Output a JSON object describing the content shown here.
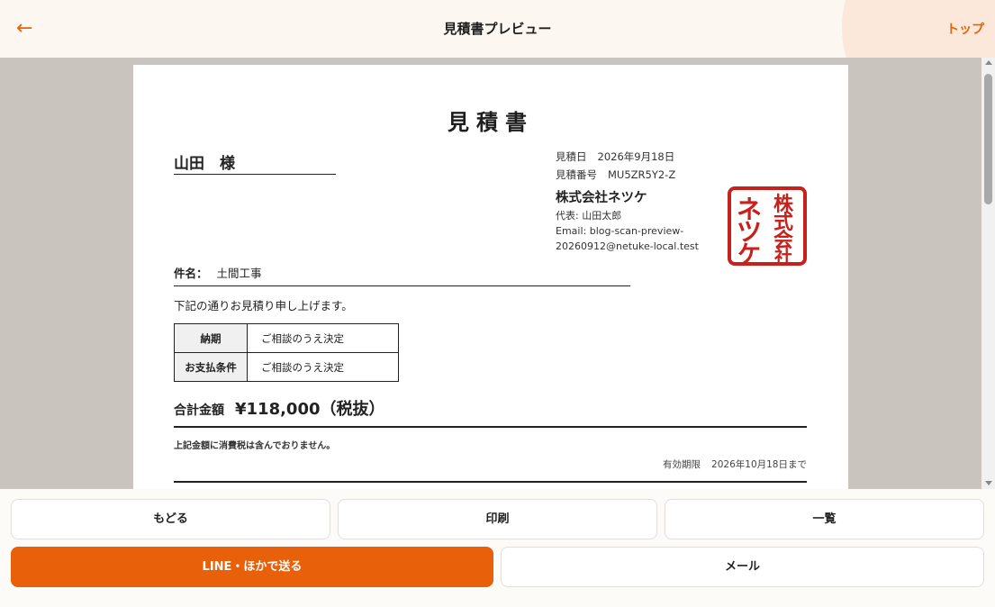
{
  "header": {
    "back_icon": "←",
    "title": "見積書プレビュー",
    "top_link": "トップ"
  },
  "document": {
    "title": "見積書",
    "customer": "山田　様",
    "estimate_date_label": "見積日",
    "estimate_date": "2026年9月18日",
    "estimate_number_label": "見積番号",
    "estimate_number": "MU5ZR5Y2-Z",
    "company_name": "株式会社ネツケ",
    "representative": "代表: 山田太郎",
    "email_line1": "Email: blog-scan-preview-",
    "email_line2": "20260912@netuke-local.test",
    "seal_text": "株式会社ネツケ",
    "seal_color": "#c8201a",
    "subject_label": "件名：",
    "subject": "土間工事",
    "intro": "下記の通りお見積り申し上げます。",
    "terms": [
      {
        "label": "納期",
        "value": "ご相談のうえ決定"
      },
      {
        "label": "お支払条件",
        "value": "ご相談のうえ決定"
      }
    ],
    "total_label": "合計金額",
    "total_amount": "¥118,000（税抜）",
    "tax_note": "上記金額に消費税は含んでおりません。",
    "validity_label": "有効期限",
    "validity": "2026年10月18日まで"
  },
  "actions": {
    "back": "もどる",
    "print": "印刷",
    "list": "一覧",
    "line_share": "LINE・ほかで送る",
    "mail": "メール"
  },
  "colors": {
    "accent": "#e8600a",
    "preview_bg": "#c9c4be"
  }
}
